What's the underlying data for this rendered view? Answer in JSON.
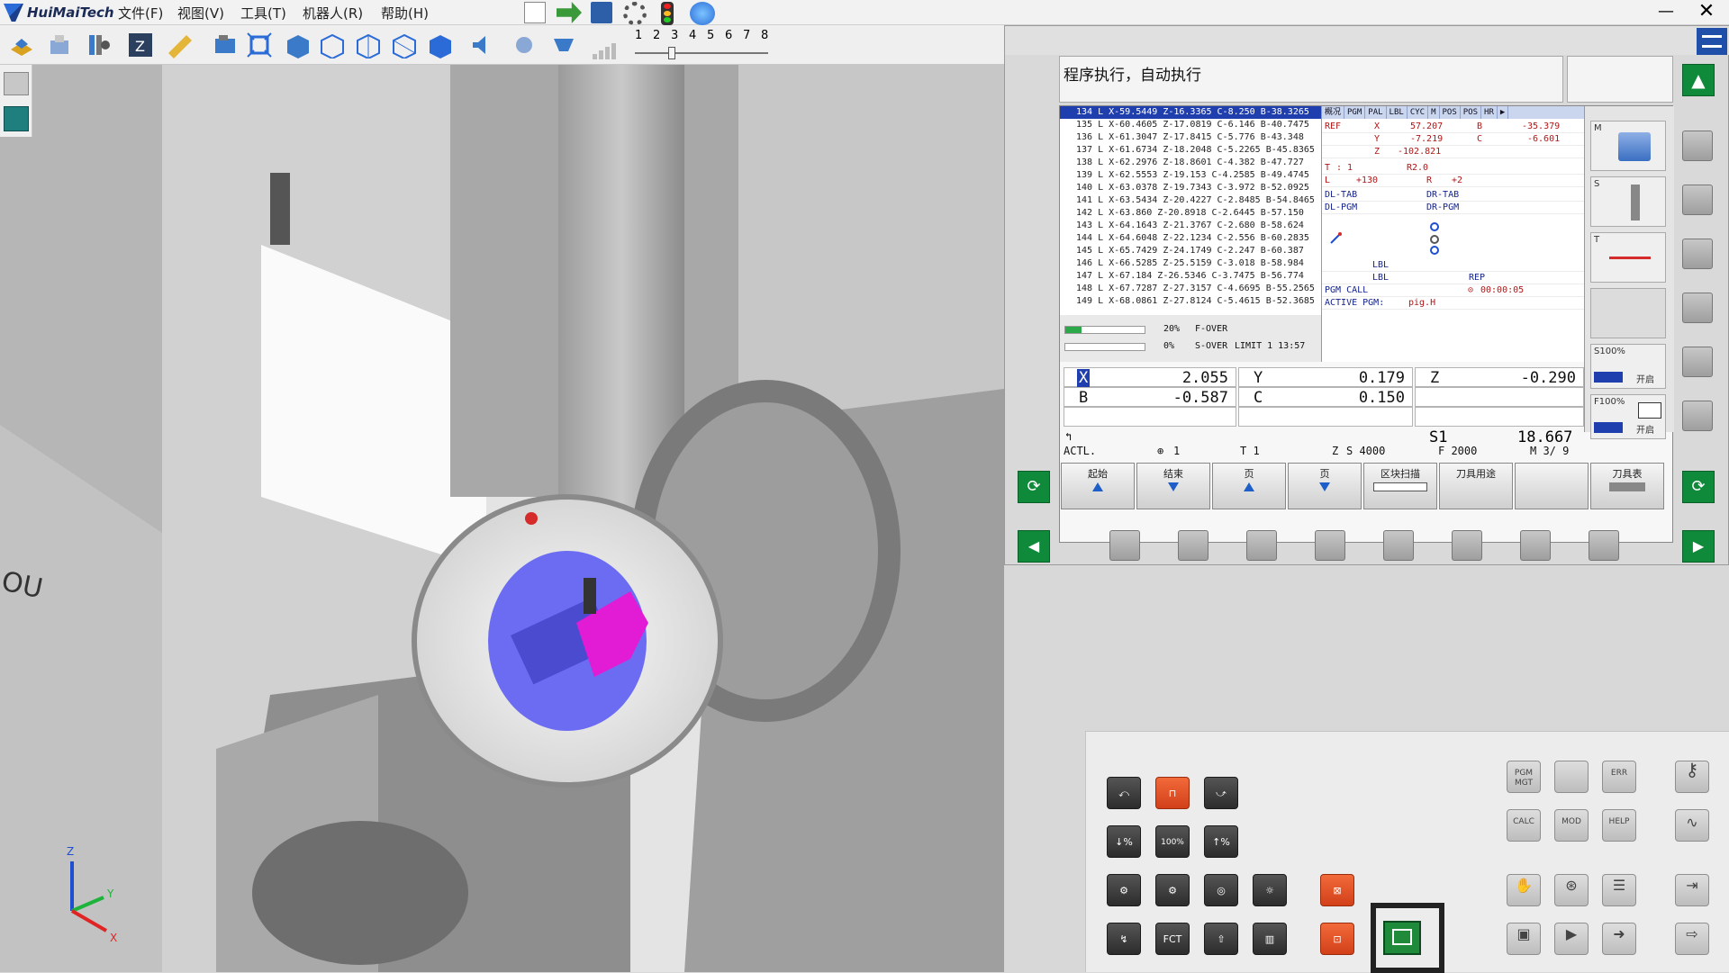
{
  "app": {
    "brand": "HuiMaiTech",
    "menu": [
      "文件(F)",
      "视图(V)",
      "工具(T)",
      "机器人(R)",
      "帮助(H)"
    ],
    "window_controls": {
      "minimize": "—",
      "close": "✕"
    }
  },
  "toolbar": {
    "speed_scale": [
      "1",
      "2",
      "3",
      "4",
      "5",
      "6",
      "7",
      "8"
    ]
  },
  "viewport": {
    "axis_labels": {
      "x": "X",
      "y": "Y",
      "z": "Z"
    },
    "wall_text": "OU"
  },
  "cnc": {
    "mode_text": "程序执行，自动执行",
    "program_lines": [
      "134 L X-59.5449 Z-16.3365 C-8.250 B-38.3265",
      "135 L X-60.4605 Z-17.0819 C-6.146 B-40.7475",
      "136 L X-61.3047 Z-17.8415 C-5.776 B-43.348",
      "137 L X-61.6734 Z-18.2048 C-5.2265 B-45.8365",
      "138 L X-62.2976 Z-18.8601 C-4.382 B-47.727",
      "139 L X-62.5553 Z-19.153 C-4.2585 B-49.4745",
      "140 L X-63.0378 Z-19.7343 C-3.972 B-52.0925",
      "141 L X-63.5434 Z-20.4227 C-2.8485 B-54.8465",
      "142 L X-63.860 Z-20.8918 C-2.6445 B-57.150",
      "143 L X-64.1643 Z-21.3767 C-2.680 B-58.624",
      "144 L X-64.6048 Z-22.1234 C-2.556 B-60.2835",
      "145 L X-65.7429 Z-24.1749 C-2.247 B-60.387",
      "146 L X-66.5285 Z-25.5159 C-3.018 B-58.984",
      "147 L X-67.184 Z-26.5346 C-3.7475 B-56.774",
      "148 L X-67.7287 Z-27.3157 C-4.6695 B-55.2565",
      "149 L X-68.0861 Z-27.8124 C-5.4615 B-52.3685"
    ],
    "override": {
      "f_percent": "20%",
      "f_label": "F-OVER",
      "f_fill": 0.2,
      "s_percent": "0%",
      "s_label": "S-OVER",
      "s_fill": 0.0,
      "limit_text": "LIMIT 1 13:57"
    },
    "status": {
      "tabs": [
        "概况",
        "PGM",
        "PAL",
        "LBL",
        "CYC",
        "M",
        "POS",
        "POS",
        "HR"
      ],
      "ref": "REF",
      "x_label": "X",
      "x_val": "57.207",
      "b_label": "B",
      "b_val": "-35.379",
      "y_label": "Y",
      "y_val": "-7.219",
      "c_label": "C",
      "c_val": "-6.601",
      "z_label": "Z",
      "z_val": "-102.821",
      "t_label": "T",
      "t_val": ": 1",
      "r_val": "R2.0",
      "l_label": "L",
      "l_val": "+130",
      "r_label": "R",
      "r2_val": "+2",
      "dl_tab": "DL-TAB",
      "dr_tab": "DR-TAB",
      "dl_pgm": "DL-PGM",
      "dr_pgm": "DR-PGM",
      "lbl1": "LBL",
      "lbl2": "LBL",
      "rep": "REP",
      "pgm_call": "PGM CALL",
      "time": "00:00:05",
      "active_pgm_label": "ACTIVE PGM:",
      "active_pgm": "pig.H"
    },
    "side": {
      "m_label": "M",
      "s_label": "S",
      "t_label": "T",
      "s100": "S100%",
      "s100_btn": "开启",
      "f100": "F100%",
      "f100_btn": "开启"
    },
    "positions": {
      "x_label": "X",
      "x": "2.055",
      "y_label": "Y",
      "y": "0.179",
      "z_label": "Z",
      "z": "-0.290",
      "b_label": "B",
      "b": "-0.587",
      "c_label": "C",
      "c": "0.150",
      "s1_label": "S1",
      "s1": "18.667"
    },
    "actl": {
      "label": "ACTL.",
      "datum": "1",
      "tool": "T 1",
      "z": "Z",
      "spindle": "S 4000",
      "feed": "F 2000",
      "m": "M 3/ 9"
    },
    "softkeys": [
      "起始",
      "结束",
      "页",
      "页",
      "区块扫描",
      "刀具用途",
      "",
      "刀具表"
    ]
  },
  "keypad": {
    "fct": "FCT",
    "right": [
      "PGM MGT",
      "",
      "ERR",
      "CALC",
      "MOD",
      "HELP"
    ]
  },
  "colors": {
    "accent_green": "#0f8a3a",
    "highlight_blue": "#1f3fae",
    "orange_key": "#e2532a",
    "part_magenta": "#e21bd5",
    "fixture_blue": "#6b6cf2"
  }
}
